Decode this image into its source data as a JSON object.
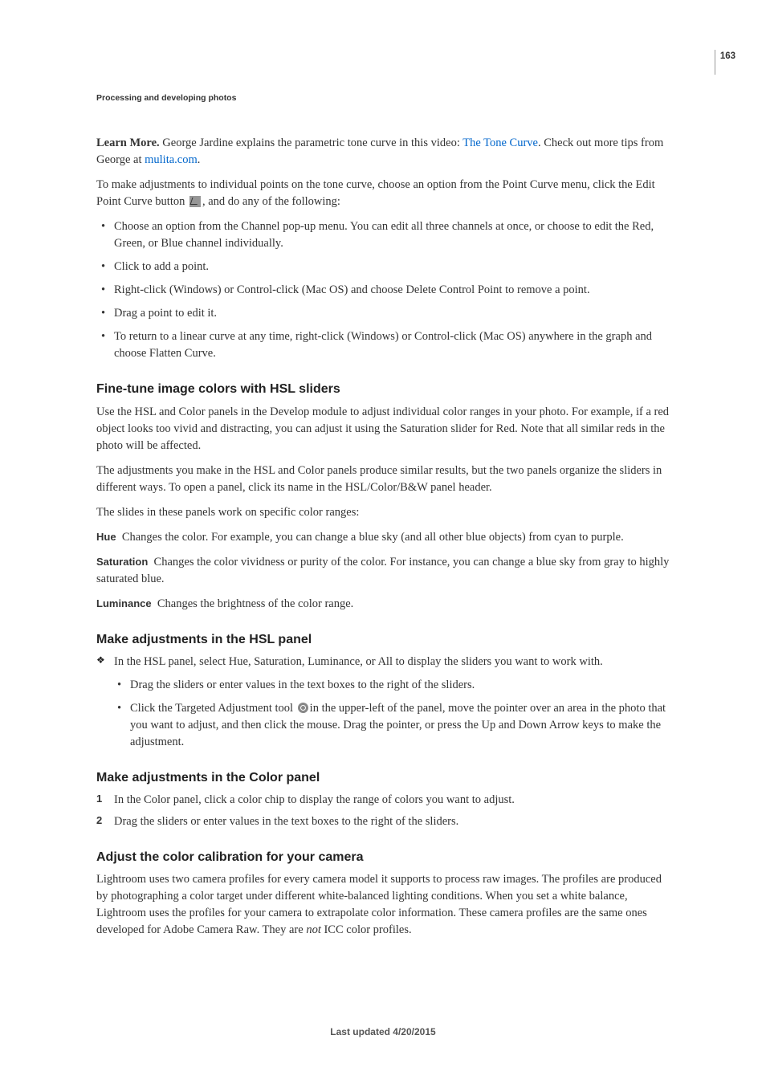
{
  "page_number": "163",
  "breadcrumb": "Processing and developing photos",
  "intro": {
    "learn_more_label": "Learn More.",
    "learn_more_before": " George Jardine explains the parametric tone curve in this video: ",
    "learn_more_link": "The Tone Curve",
    "learn_more_after1": ". Check out more tips from George at ",
    "learn_more_link2": "mulita.com",
    "learn_more_after2": ".",
    "para2_before": "To make adjustments to individual points on the tone curve, choose an option from the Point Curve menu, click the Edit Point Curve button ",
    "para2_after": ", and do any of the following:"
  },
  "intro_bullets": [
    "Choose an option from the Channel pop-up menu. You can edit all three channels at once, or choose to edit the Red, Green, or Blue channel individually.",
    "Click to add a point.",
    "Right-click (Windows) or Control-click (Mac OS) and choose Delete Control Point to remove a point.",
    "Drag a point to edit it.",
    "To return to a linear curve at any time, right-click (Windows) or Control-click (Mac OS) anywhere in the graph and choose Flatten Curve."
  ],
  "hsl": {
    "heading": "Fine-tune image colors with HSL sliders",
    "p1": "Use the HSL and Color panels in the Develop module to adjust individual color ranges in your photo. For example, if a red object looks too vivid and distracting, you can adjust it using the Saturation slider for Red. Note that all similar reds in the photo will be affected.",
    "p2": "The adjustments you make in the HSL and Color panels produce similar results, but the two panels organize the sliders in different ways. To open a panel, click its name in the HSL/Color/B&W panel header.",
    "p3": "The slides in these panels work on specific color ranges:",
    "defs": [
      {
        "term": "Hue",
        "desc": "Changes the color. For example, you can change a blue sky (and all other blue objects) from cyan to purple."
      },
      {
        "term": "Saturation",
        "desc": "Changes the color vividness or purity of the color. For instance, you can change a blue sky from gray to highly saturated blue."
      },
      {
        "term": "Luminance",
        "desc": "Changes the brightness of the color range."
      }
    ]
  },
  "hsl_panel": {
    "heading": "Make adjustments in the HSL panel",
    "step": "In the HSL panel, select Hue, Saturation, Luminance, or All to display the sliders you want to work with.",
    "sub1": "Drag the sliders or enter values in the text boxes to the right of the sliders.",
    "sub2_before": "Click the Targeted Adjustment tool ",
    "sub2_after": "in the upper-left of the panel, move the pointer over an area in the photo that you want to adjust, and then click the mouse. Drag the pointer, or press the Up and Down Arrow keys to make the adjustment."
  },
  "color_panel": {
    "heading": "Make adjustments in the Color panel",
    "step1": "In the Color panel, click a color chip to display the range of colors you want to adjust.",
    "step2": "Drag the sliders or enter values in the text boxes to the right of the sliders."
  },
  "calibration": {
    "heading": "Adjust the color calibration for your camera",
    "p_before": "Lightroom uses two camera profiles for every camera model it supports to process raw images. The profiles are produced by photographing a color target under different white-balanced lighting conditions. When you set a white balance, Lightroom uses the profiles for your camera to extrapolate color information. These camera profiles are the same ones developed for Adobe Camera Raw. They are ",
    "p_not": "not",
    "p_after": " ICC color profiles."
  },
  "footer": "Last updated 4/20/2015"
}
